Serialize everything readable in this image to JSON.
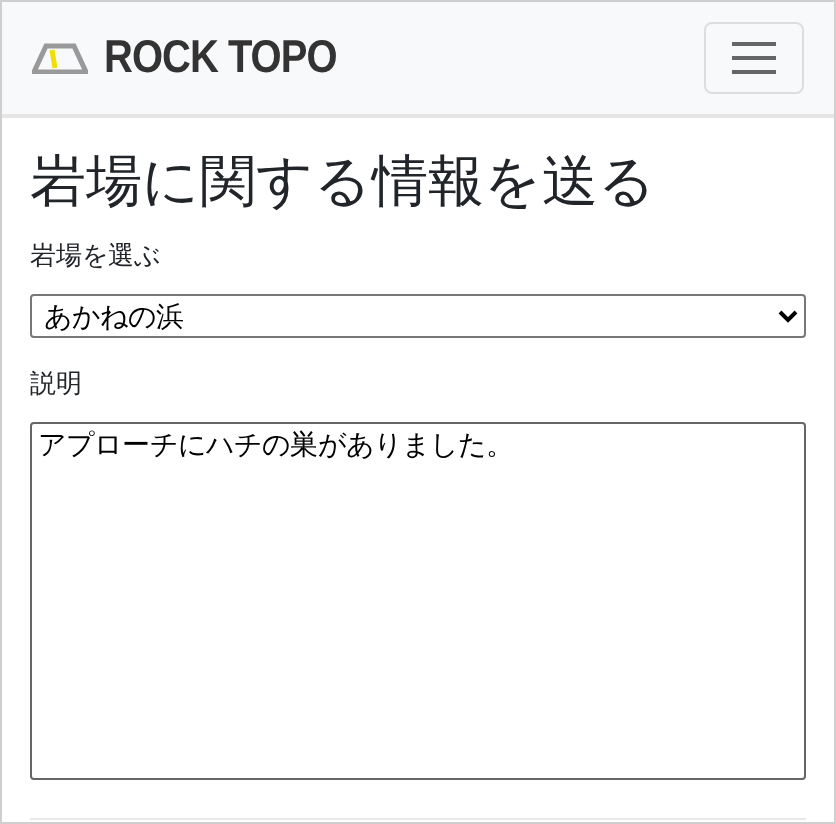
{
  "navbar": {
    "brand": "ROCK TOPO"
  },
  "page": {
    "title": "岩場に関する情報を送る"
  },
  "form": {
    "crag_label": "岩場を選ぶ",
    "crag_value": "あかねの浜",
    "description_label": "説明",
    "description_value": "アプローチにハチの巣がありました。"
  }
}
